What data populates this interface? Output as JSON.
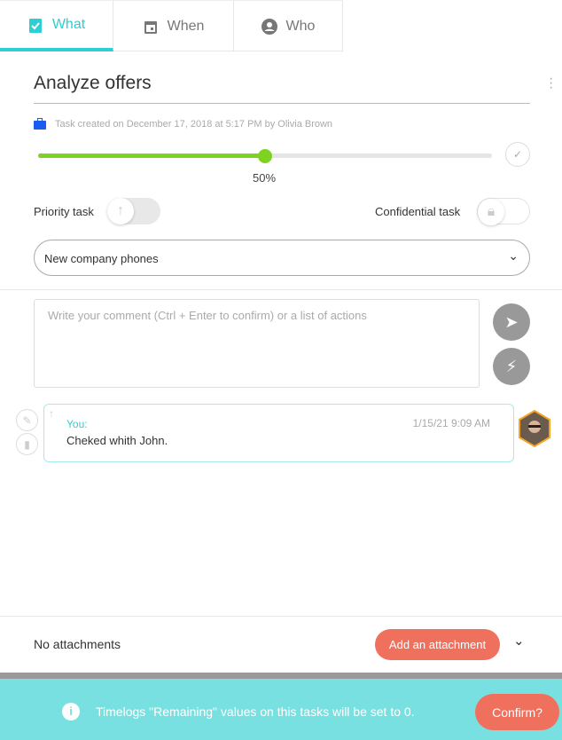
{
  "tabs": [
    {
      "label": "What",
      "icon": "clipboard-check-icon",
      "active": true
    },
    {
      "label": "When",
      "icon": "calendar-icon"
    },
    {
      "label": "Who",
      "icon": "account-circle-icon"
    }
  ],
  "task": {
    "title": "Analyze offers",
    "meta": "Task created on December 17, 2018 at 5:17 PM by Olivia Brown",
    "progress_percent": 50,
    "progress_label": "50%"
  },
  "toggles": {
    "priority_label": "Priority task",
    "priority_on": false,
    "confidential_label": "Confidential task",
    "confidential_on": false
  },
  "project_select": {
    "value": "New company phones"
  },
  "comment_input": {
    "placeholder": "Write your comment (Ctrl + Enter to confirm) or a list of actions"
  },
  "comments": [
    {
      "author": "You:",
      "time": "1/15/21 9:09 AM",
      "text": "Cheked whith John."
    }
  ],
  "attachments": {
    "label": "No attachments",
    "add_button": "Add an attachment"
  },
  "banner": {
    "message": "Timelogs \"Remaining\" values on this tasks will be set to 0.",
    "confirm_button": "Confirm?"
  },
  "colors": {
    "accent": "#2ccfd3",
    "progress": "#7ed321",
    "danger": "#f0705e",
    "banner": "#78e0e0"
  }
}
